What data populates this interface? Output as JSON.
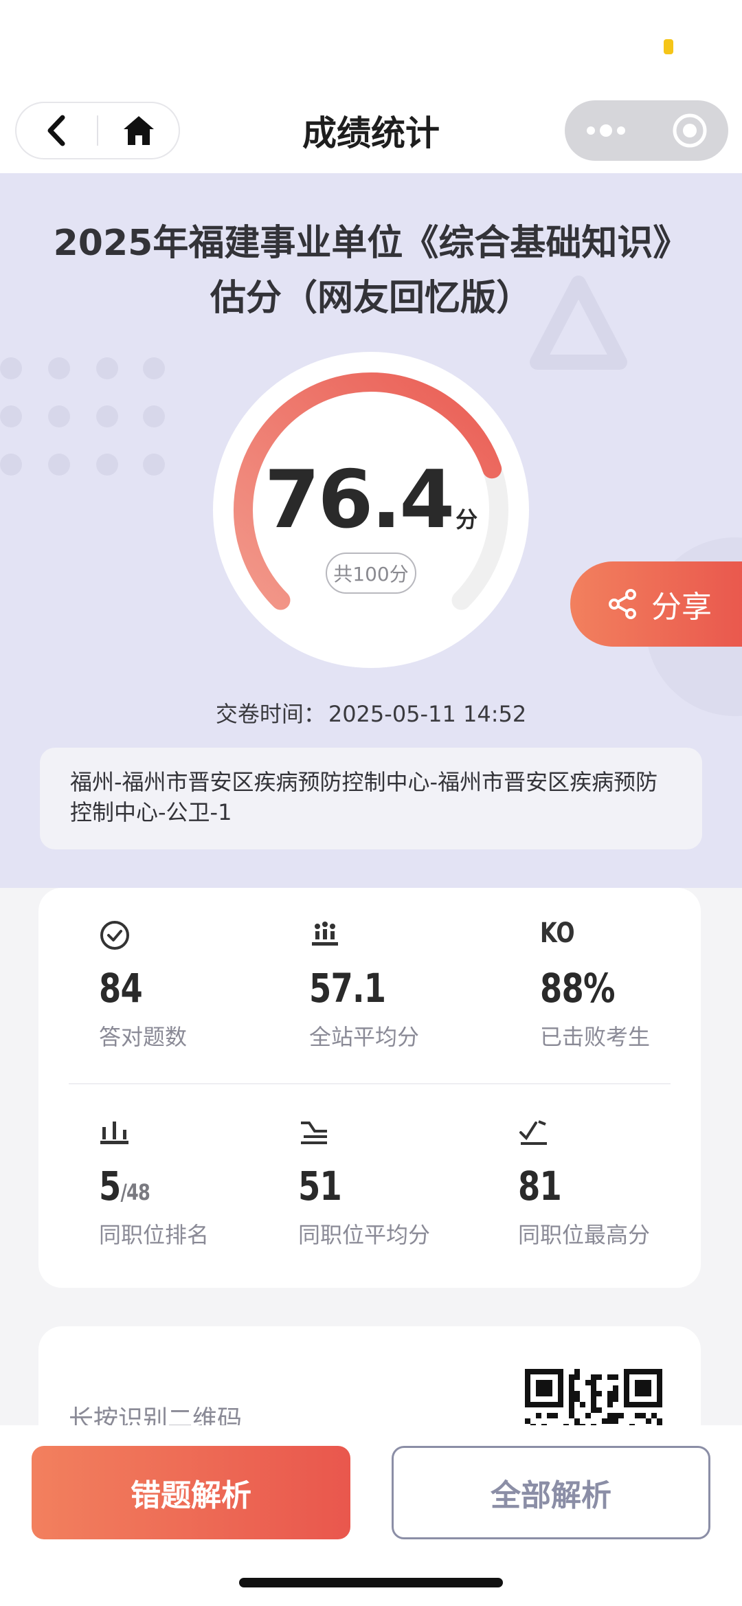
{
  "nav": {
    "title": "成绩统计",
    "back_icon": "chevron-left-icon",
    "home_icon": "home-icon",
    "more_icon": "more-dots-icon",
    "close_icon": "target-circle-icon"
  },
  "hero": {
    "title_line1": "2025年福建事业单位《综合基础知识》",
    "title_line2": "估分（网友回忆版）",
    "score": "76.4",
    "score_unit": "分",
    "total": "共100分",
    "score_fraction": 0.764,
    "share_label": "分享",
    "share_icon": "share-icon",
    "submit_time_label": "交卷时间：",
    "submit_time_value": "2025-05-11 14:52",
    "position_text": "福州-福州市晋安区疾病预防控制中心-福州市晋安区疾病预防控制中心-公卫-1",
    "accent_start": "#f2805e",
    "accent_end": "#e9574d"
  },
  "stats": {
    "row1": [
      {
        "icon": "check-circle-icon",
        "value": "84",
        "label": "答对题数"
      },
      {
        "icon": "crowd-icon",
        "value": "57.1",
        "label": "全站平均分"
      },
      {
        "icon": "ko-icon",
        "icon_text": "KO",
        "value": "88%",
        "label": "已击败考生"
      }
    ],
    "row2": [
      {
        "icon": "podium-icon",
        "value": "5",
        "value_sub": "/48",
        "label": "同职位排名"
      },
      {
        "icon": "average-icon",
        "value": "51",
        "label": "同职位平均分"
      },
      {
        "icon": "peak-icon",
        "value": "81",
        "label": "同职位最高分"
      }
    ]
  },
  "qr": {
    "hint": "长按识别二维码",
    "icon": "qr-code-icon"
  },
  "bottom": {
    "wrong_label": "错题解析",
    "all_label": "全部解析"
  }
}
